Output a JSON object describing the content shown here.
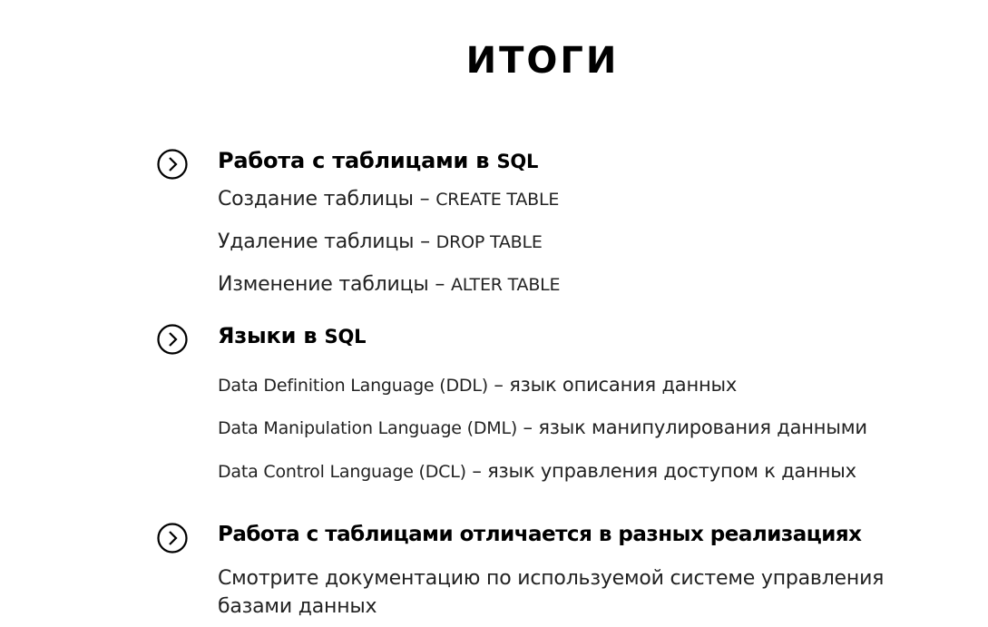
{
  "title": "ИТОГИ",
  "sections": [
    {
      "heading_main": "Работа с таблицами в ",
      "heading_suffix": "SQL",
      "items": [
        {
          "text": "Создание таблицы – ",
          "cmd": "CREATE TABLE"
        },
        {
          "text": "Удаление таблицы – ",
          "cmd": "DROP TABLE"
        },
        {
          "text": "Изменение таблицы – ",
          "cmd": "ALTER TABLE"
        }
      ]
    },
    {
      "heading_main": "Языки в ",
      "heading_suffix": "SQL",
      "items": [
        {
          "en": "Data Definition Language (DDL)",
          "ru": " – язык описания данных"
        },
        {
          "en": "Data Manipulation Language (DML)",
          "ru": " – язык манипулирования данными"
        },
        {
          "en": "Data Control Language (DCL)",
          "ru": " – язык управления доступом к данных"
        }
      ]
    },
    {
      "heading_main": "Работа с таблицами отличается в разных реализациях",
      "items": [
        {
          "text": "Смотрите документацию по используемой системе управления базами данных"
        }
      ]
    }
  ],
  "icons": {
    "bullet": "chevron-right-circle-icon"
  }
}
